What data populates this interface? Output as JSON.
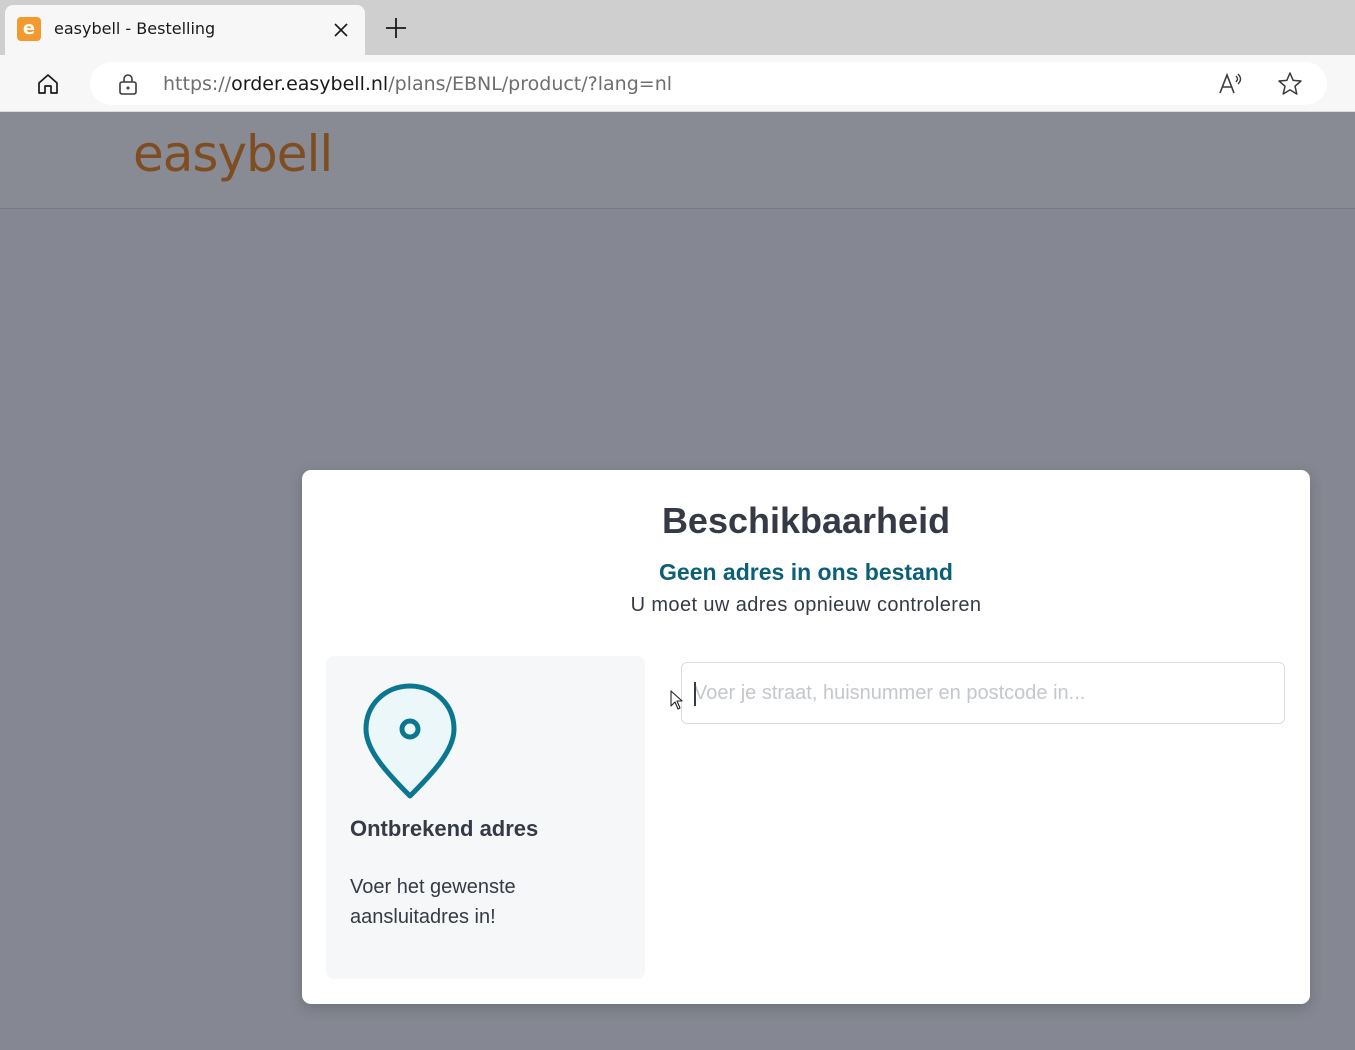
{
  "browser": {
    "tab": {
      "title": "easybell - Bestelling",
      "favicon_letter": "e"
    },
    "address": {
      "scheme": "https://",
      "host": "order.easybell.nl",
      "path": "/plans/EBNL/product/?lang=nl"
    },
    "icons": [
      "home-icon",
      "lock-icon",
      "read-aloud-icon",
      "star-icon",
      "close-icon",
      "plus-icon"
    ]
  },
  "site": {
    "logo": "easybell",
    "colors": {
      "logo": "#7f4d22",
      "accent": "#0b5f78",
      "overlay": "#858892"
    }
  },
  "modal": {
    "title": "Beschikbaarheid",
    "subtitle": "Geen adres in ons bestand",
    "text": "U moet uw adres opnieuw controleren",
    "card": {
      "icon": "map-pin-icon",
      "title": "Ontbrekend adres",
      "text": "Voer het gewenste aansluitadres in!"
    },
    "input": {
      "value": "",
      "placeholder": "Voer je straat, huisnummer en postcode in..."
    }
  }
}
